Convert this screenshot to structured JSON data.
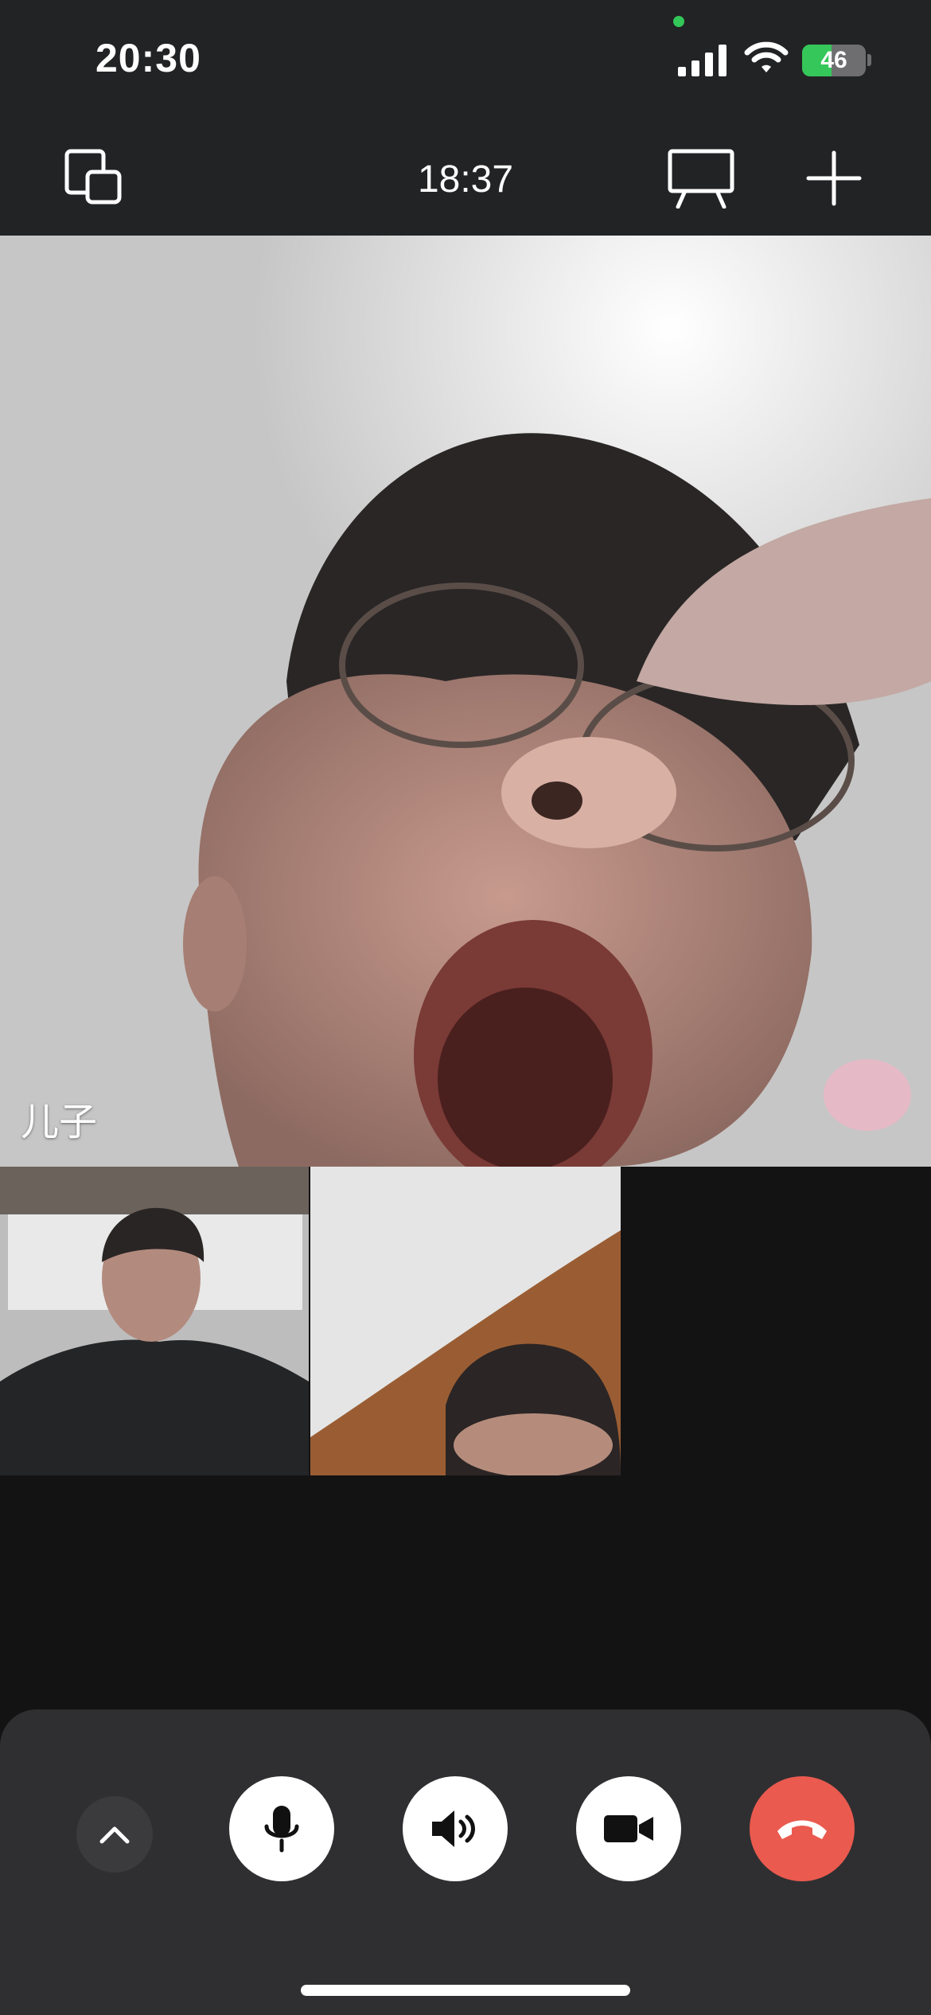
{
  "status_bar": {
    "time": "20:30",
    "battery_level": "46",
    "battery_charging": true,
    "signal_icon": "cellular-signal-icon",
    "wifi_icon": "wifi-icon"
  },
  "call": {
    "duration": "18:37",
    "main_participant_name": "儿子",
    "icons": {
      "switch_layout": "switch-layout-icon",
      "screen_share": "screen-share-icon",
      "add_participant": "add-participant-icon"
    }
  },
  "controls": {
    "buttons": [
      "collapse-icon",
      "microphone-icon",
      "speaker-icon",
      "video-camera-icon",
      "hang-up-icon"
    ]
  },
  "colors": {
    "hangup": "#ea5a4f",
    "battery_green": "#35c759",
    "camera_indicator": "#33c759",
    "panel": "#2f2f31"
  }
}
